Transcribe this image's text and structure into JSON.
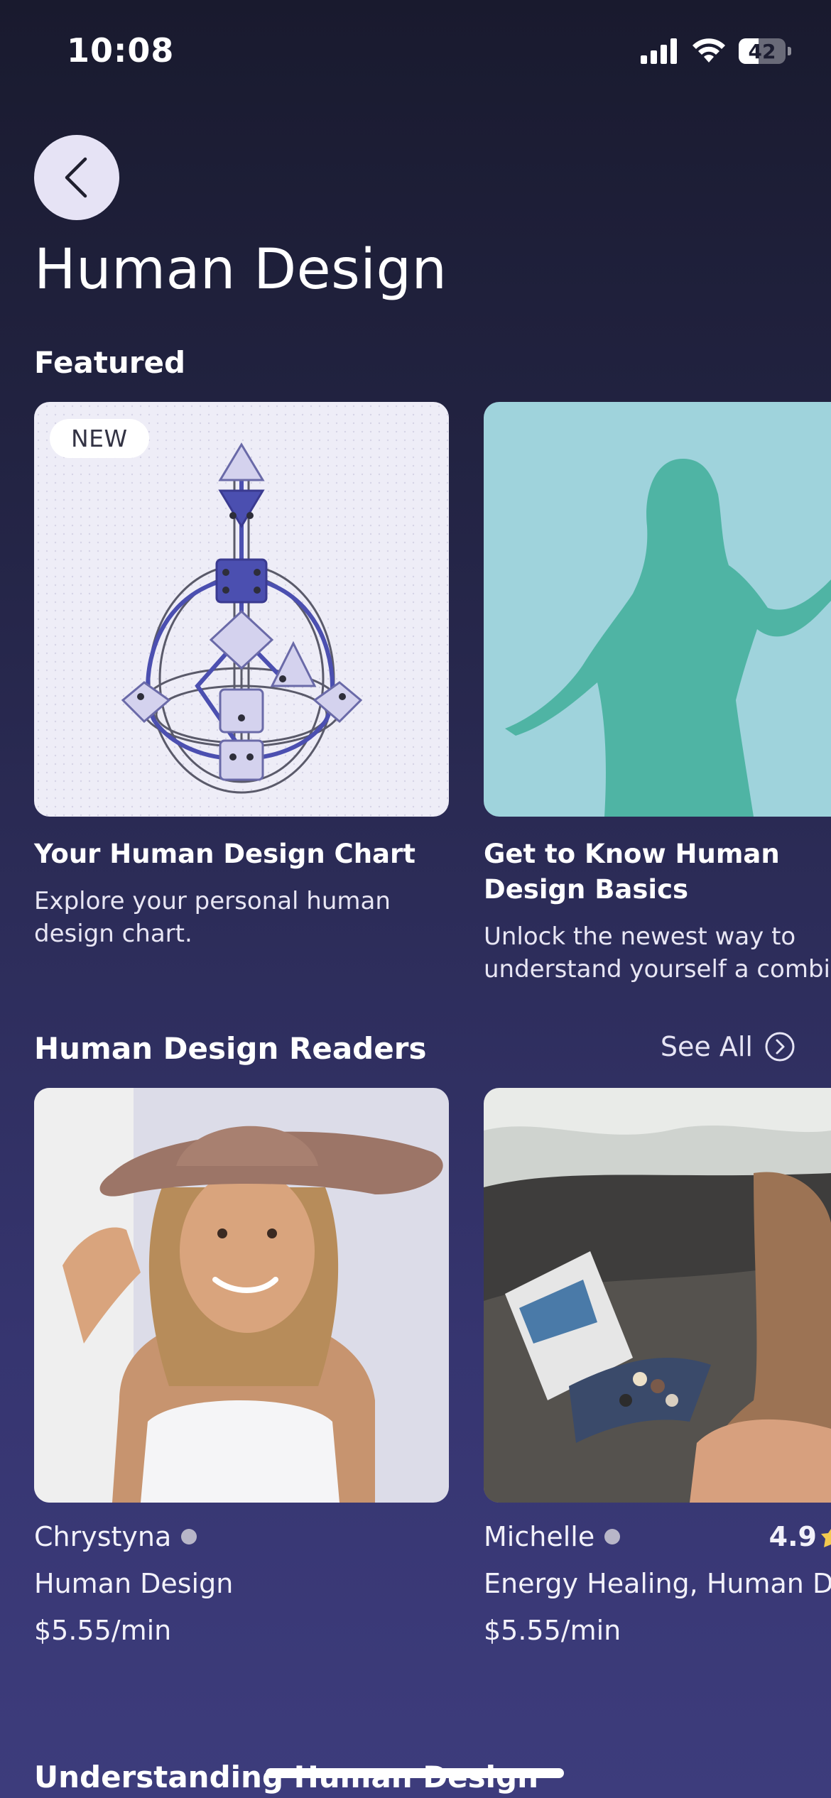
{
  "status_bar": {
    "time": "10:08",
    "battery": "42",
    "battery_level_percent": 42
  },
  "header": {
    "title": "Human Design"
  },
  "featured": {
    "title": "Featured",
    "cards": [
      {
        "badge": "NEW",
        "title": "Your Human Design Chart",
        "description": "Explore your personal human design chart."
      },
      {
        "title": "Get to Know Human Design Basics",
        "description": "Unlock the newest way to understand yourself a combin"
      }
    ]
  },
  "readers": {
    "title": "Human Design Readers",
    "see_all": "See All",
    "items": [
      {
        "name": "Chrystyna",
        "specialty": "Human Design",
        "price": "$5.55/min"
      },
      {
        "name": "Michelle",
        "rating": "4.9",
        "specialty": "Energy Healing, Human Des",
        "price": "$5.55/min"
      }
    ]
  },
  "understanding": {
    "title": "Understanding Human Design"
  },
  "icons": {
    "back": "chevron-left-icon",
    "see_all": "chevron-right-circle-icon",
    "signal": "cellular-signal-icon",
    "wifi": "wifi-icon",
    "battery": "battery-icon",
    "rating": "star-icon"
  },
  "colors": {
    "background_top": "#191a2e",
    "background_bottom": "#3d3c7c",
    "back_button": "#e6e3f5",
    "featured_card_2": "#9fd3dc",
    "silhouette": "#4fb4a4",
    "online_dot": "#b8b6c8"
  }
}
